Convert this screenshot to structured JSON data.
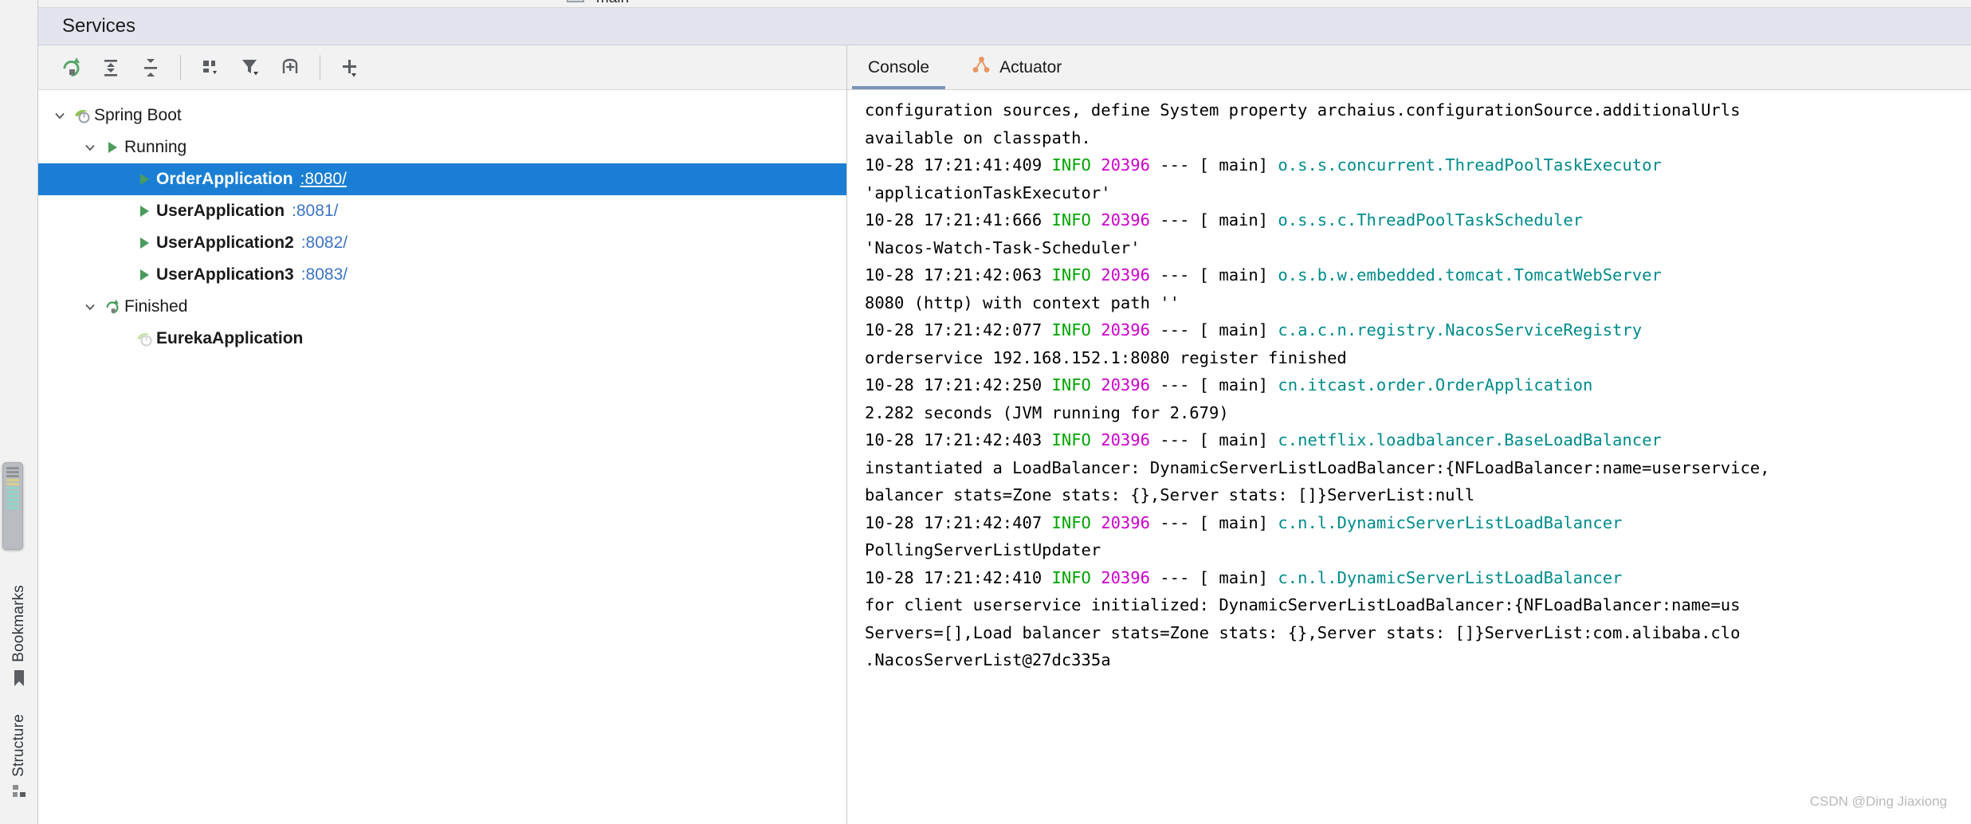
{
  "window": {
    "title": "Services",
    "ghost_tab_text": "main"
  },
  "left_rail": {
    "items": [
      {
        "label": "Bookmarks",
        "icon": "bookmark-icon"
      },
      {
        "label": "Structure",
        "icon": "structure-icon"
      }
    ]
  },
  "tree_toolbar": {
    "buttons": [
      {
        "name": "rerun-button",
        "icon": "rerun-icon",
        "tooltip": "Rerun"
      },
      {
        "name": "expand-all-button",
        "icon": "expand-all-icon",
        "tooltip": "Expand All"
      },
      {
        "name": "collapse-all-button",
        "icon": "collapse-all-icon",
        "tooltip": "Collapse All"
      },
      {
        "name": "group-by-button",
        "icon": "group-by-icon",
        "tooltip": "Group By"
      },
      {
        "name": "filter-button",
        "icon": "filter-icon",
        "tooltip": "Filter"
      },
      {
        "name": "show-services-button",
        "icon": "add-frame-icon",
        "tooltip": "Show Services"
      },
      {
        "name": "add-service-button",
        "icon": "plus-icon",
        "tooltip": "Add Service"
      }
    ]
  },
  "run_toolbar": {
    "buttons": [
      {
        "name": "rerun-icon",
        "icon": "rerun-icon"
      },
      {
        "name": "debug-icon",
        "icon": "debug-icon"
      },
      {
        "name": "stop-icon",
        "icon": "stop-icon"
      },
      {
        "name": "settings-icon",
        "icon": "wrench-icon"
      },
      {
        "name": "screenshot-icon",
        "icon": "camera-icon"
      },
      {
        "name": "attach-debug-icon",
        "icon": "debug-attach-icon"
      },
      {
        "name": "exit-icon",
        "icon": "exit-icon"
      },
      {
        "name": "layout-icon",
        "icon": "layout-icon"
      }
    ]
  },
  "tree": {
    "nodes": [
      {
        "label": "Spring Boot",
        "port": "",
        "level": 0,
        "expanded": true,
        "icon": "spring-boot-icon",
        "bold": false,
        "selected": false
      },
      {
        "label": "Running",
        "port": "",
        "level": 1,
        "expanded": true,
        "icon": "run-green-icon",
        "bold": false,
        "selected": false
      },
      {
        "label": "OrderApplication",
        "port": ":8080/",
        "level": 2,
        "expanded": null,
        "icon": "run-green-icon",
        "bold": true,
        "selected": true
      },
      {
        "label": "UserApplication",
        "port": ":8081/",
        "level": 2,
        "expanded": null,
        "icon": "run-green-icon",
        "bold": true,
        "selected": false
      },
      {
        "label": "UserApplication2",
        "port": ":8082/",
        "level": 2,
        "expanded": null,
        "icon": "run-green-icon",
        "bold": true,
        "selected": false
      },
      {
        "label": "UserApplication3",
        "port": ":8083/",
        "level": 2,
        "expanded": null,
        "icon": "run-green-icon",
        "bold": true,
        "selected": false
      },
      {
        "label": "Finished",
        "port": "",
        "level": 1,
        "expanded": true,
        "icon": "rerun-green-icon",
        "bold": false,
        "selected": false
      },
      {
        "label": "EurekaApplication",
        "port": "",
        "level": 2,
        "expanded": null,
        "icon": "spring-boot-faded-icon",
        "bold": true,
        "selected": false
      }
    ]
  },
  "console_tabs": [
    {
      "label": "Console",
      "icon": "",
      "active": true
    },
    {
      "label": "Actuator",
      "icon": "actuator-icon",
      "active": false
    }
  ],
  "console": {
    "lines": [
      {
        "type": "cont",
        "text": "configuration sources, define System property archaius.configurationSource.additionalUrls"
      },
      {
        "type": "cont",
        "text": "available on classpath."
      },
      {
        "type": "log",
        "time": "10-28 17:21:41:409",
        "level": "INFO",
        "pid": "20396",
        "sep": "--- [",
        "thread": "main]",
        "logger": "o.s.s.concurrent.ThreadPoolTaskExecutor"
      },
      {
        "type": "cont",
        "text": "'applicationTaskExecutor'"
      },
      {
        "type": "log",
        "time": "10-28 17:21:41:666",
        "level": "INFO",
        "pid": "20396",
        "sep": "--- [",
        "thread": "main]",
        "logger": "o.s.s.c.ThreadPoolTaskScheduler"
      },
      {
        "type": "cont",
        "text": "'Nacos-Watch-Task-Scheduler'"
      },
      {
        "type": "log",
        "time": "10-28 17:21:42:063",
        "level": "INFO",
        "pid": "20396",
        "sep": "--- [",
        "thread": "main]",
        "logger": "o.s.b.w.embedded.tomcat.TomcatWebServer"
      },
      {
        "type": "cont",
        "text": "8080 (http) with context path ''"
      },
      {
        "type": "log",
        "time": "10-28 17:21:42:077",
        "level": "INFO",
        "pid": "20396",
        "sep": "--- [",
        "thread": "main]",
        "logger": "c.a.c.n.registry.NacosServiceRegistry"
      },
      {
        "type": "cont",
        "text": " orderservice 192.168.152.1:8080 register finished"
      },
      {
        "type": "log",
        "time": "10-28 17:21:42:250",
        "level": "INFO",
        "pid": "20396",
        "sep": "--- [",
        "thread": "main]",
        "logger": "cn.itcast.order.OrderApplication"
      },
      {
        "type": "cont",
        "text": "2.282 seconds (JVM running for 2.679)"
      },
      {
        "type": "log",
        "time": "10-28 17:21:42:403",
        "level": "INFO",
        "pid": "20396",
        "sep": "--- [",
        "thread": "main]",
        "logger": "c.netflix.loadbalancer.BaseLoadBalancer"
      },
      {
        "type": "cont",
        "text": "instantiated a LoadBalancer: DynamicServerListLoadBalancer:{NFLoadBalancer:name=userservice,"
      },
      {
        "type": "cont",
        "text": "balancer stats=Zone stats: {},Server stats: []}ServerList:null"
      },
      {
        "type": "log",
        "time": "10-28 17:21:42:407",
        "level": "INFO",
        "pid": "20396",
        "sep": "--- [",
        "thread": "main]",
        "logger": "c.n.l.DynamicServerListLoadBalancer"
      },
      {
        "type": "cont",
        "text": "PollingServerListUpdater"
      },
      {
        "type": "log",
        "time": "10-28 17:21:42:410",
        "level": "INFO",
        "pid": "20396",
        "sep": "--- [",
        "thread": "main]",
        "logger": "c.n.l.DynamicServerListLoadBalancer"
      },
      {
        "type": "cont",
        "text": " for client userservice initialized: DynamicServerListLoadBalancer:{NFLoadBalancer:name=us"
      },
      {
        "type": "cont",
        "text": "Servers=[],Load balancer stats=Zone stats: {},Server stats: []}ServerList:com.alibaba.clo"
      },
      {
        "type": "cont",
        "text": ".NacosServerList@27dc335a"
      }
    ]
  },
  "watermark": "CSDN @Ding Jiaxiong",
  "colors": {
    "selection_blue": "#1a7fd4",
    "title_bar": "#e2e5ee",
    "link_blue": "#3b74c4",
    "info_green": "#00a400",
    "pid_magenta": "#cc00cc",
    "logger_teal": "#008b8b",
    "actuator_orange": "#e8955f",
    "run_green": "#59a869",
    "stop_red": "#d0696b"
  }
}
